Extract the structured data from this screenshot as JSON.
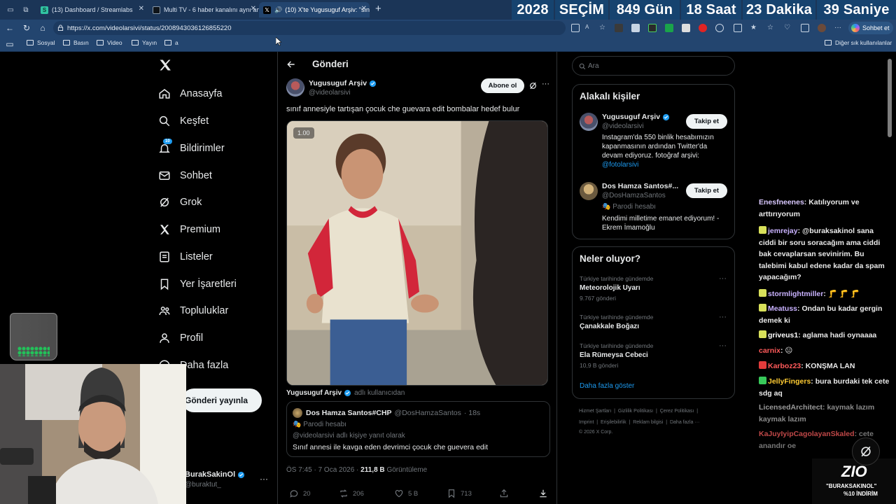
{
  "browser": {
    "tabs": [
      {
        "title": "(13) Dashboard / Streamlabs",
        "active": false
      },
      {
        "title": "Multi TV - 6 haber kanalını aynı an",
        "active": false
      },
      {
        "title": "(10) X'te Yugusuguf Arşiv: \"sın",
        "active": true
      }
    ],
    "url": "https://x.com/videolarsivi/status/2008943036126855220",
    "bookmarks": [
      "Sosyal",
      "Basın",
      "Video",
      "Yayın",
      "a"
    ],
    "other_bookmarks": "Diğer sık kullanılanlar",
    "copilot_label": "Sohbet et",
    "icons": [
      "back-icon",
      "refresh-icon",
      "home-icon",
      "menu-icon"
    ]
  },
  "countdown": {
    "year": "2028",
    "label": "SEÇİM",
    "days": "849 Gün",
    "hours": "18 Saat",
    "minutes": "23 Dakika",
    "seconds": "39 Saniye",
    "bg_color": "#16436f"
  },
  "x_nav": {
    "items": [
      {
        "label": "Anasayfa",
        "icon": "home-icon"
      },
      {
        "label": "Keşfet",
        "icon": "search-icon"
      },
      {
        "label": "Bildirimler",
        "icon": "bell-icon",
        "badge": "10"
      },
      {
        "label": "Sohbet",
        "icon": "mail-icon"
      },
      {
        "label": "Grok",
        "icon": "grok-icon"
      },
      {
        "label": "Premium",
        "icon": "x-icon"
      },
      {
        "label": "Listeler",
        "icon": "list-icon"
      },
      {
        "label": "Yer İşaretleri",
        "icon": "bookmark-icon"
      },
      {
        "label": "Topluluklar",
        "icon": "people-icon"
      },
      {
        "label": "Profil",
        "icon": "person-icon"
      },
      {
        "label": "Daha fazla",
        "icon": "more-circle-icon"
      }
    ],
    "post_button": "Gönderi yayınla",
    "account_name": "BurakSakinOl",
    "account_handle": "@buraktut_"
  },
  "post": {
    "header_title": "Gönderi",
    "author_name": "Yugusuguf Arşiv",
    "author_handle": "@videolarsivi",
    "subscribe_label": "Abone ol",
    "text": "sınıf annesiyle tartışan çocuk che guevara edit bombalar hedef bulur",
    "video_speed": "1.00",
    "by_name": "Yugusuguf Arşiv",
    "by_suffix": "adlı kullanıcıdan",
    "quote": {
      "name": "Dos Hamza Santos#CHP",
      "handle": "@DosHamzaSantos",
      "time": "· 18s",
      "parody": "Parodi hesabı",
      "reply_to": "@videolarsivi adlı kişiye yanıt olarak",
      "text": "Sınıf annesi ile kavga eden devrimci çocuk che guevera edit"
    },
    "time": "ÖS 7:45 · 7 Oca 2026 ·",
    "views_count": "211,8 B",
    "views_label": "Görüntüleme",
    "actions": {
      "replies": "20",
      "reposts": "206",
      "likes": "5 B",
      "bookmarks": "713"
    }
  },
  "sidebar": {
    "search_placeholder": "Ara",
    "related_title": "Alakalı kişiler",
    "related": [
      {
        "name": "Yugusuguf Arşiv",
        "handle": "@videolarsivi",
        "bio": "Instagram'da 550 binlik hesabımızın kapanmasının ardından Twitter'da devam ediyoruz. fotoğraf arşivi:",
        "bio_link": "@fotolarsivi",
        "follow": "Takip et"
      },
      {
        "name": "Dos Hamza Santos#...",
        "handle": "@DosHamzaSantos",
        "parody": "Parodi hesabı",
        "bio": "Kendimi milletime emanet ediyorum! - Ekrem İmamoğlu",
        "follow": "Takip et"
      }
    ],
    "trends_title": "Neler oluyor?",
    "trends": [
      {
        "category": "Türkiye tarihinde gündemde",
        "title": "Meteorolojik Uyarı",
        "count": "9.767 gönderi"
      },
      {
        "category": "Türkiye tarihinde gündemde",
        "title": "Çanakkale Boğazı",
        "count": ""
      },
      {
        "category": "Türkiye tarihinde gündemde",
        "title": "Ela Rümeysa Cebeci",
        "count": "10,9 B gönderi"
      }
    ],
    "show_more": "Daha fazla göster",
    "footer_links": [
      "Hizmet Şartları",
      "Gizlilik Politikası",
      "Çerez Politikası",
      "Imprint",
      "Erişilebilirlik",
      "Reklam bilgisi",
      "Daha fazla ···"
    ],
    "copyright": "© 2026 X Corp."
  },
  "chat": {
    "messages": [
      {
        "user": "Enesfneenes",
        "text": "Katılıyorum ve arttırıyorum",
        "color": "#d9c8ff",
        "badge": ""
      },
      {
        "user": "jemrejay",
        "text": "@buraksakinol sana ciddi bir soru soracağım ama ciddi bak cevaplarsan sevinirim. Bu talebimi kabul edene kadar da spam yapacağım?",
        "color": "#c9b2ff",
        "badge": "#d8e05a"
      },
      {
        "user": "stormlightmiller",
        "text": "🦵 🦵 🦵",
        "color": "#c9b2ff",
        "badge": "#d8e05a"
      },
      {
        "user": "Meatuss",
        "text": "Ondan bu kadar gergin demek ki",
        "color": "#c9b2ff",
        "badge": "#d8e05a"
      },
      {
        "user": "griveus1",
        "text": "aglama hadi oynaaaa",
        "color": "#ffffff",
        "badge": "#d8e05a"
      },
      {
        "user": "carnix",
        "text": "😐",
        "color": "#ff5a5a",
        "badge": ""
      },
      {
        "user": "Karboz23",
        "text": "KONŞMA LAN",
        "color": "#ff5a5a",
        "badge": "#e23b3b"
      },
      {
        "user": "JellyFingers",
        "text": "bura burdaki tek cete sdg aq",
        "color": "#ffcc33",
        "badge": "#38c95a"
      },
      {
        "user": "LicensedArchitect",
        "text": "kaymak lazım kaymak lazım",
        "color": "#9a9a9a",
        "badge": ""
      },
      {
        "user": "KaJuyIyipCagolayanSkaled",
        "text": "cete anandır oe",
        "color": "#c04848",
        "badge": ""
      }
    ]
  },
  "promo": {
    "brand": "ZIO",
    "line1": "\"BURAKSAKINOL\"",
    "line2": "%10 İNDİRİM"
  }
}
